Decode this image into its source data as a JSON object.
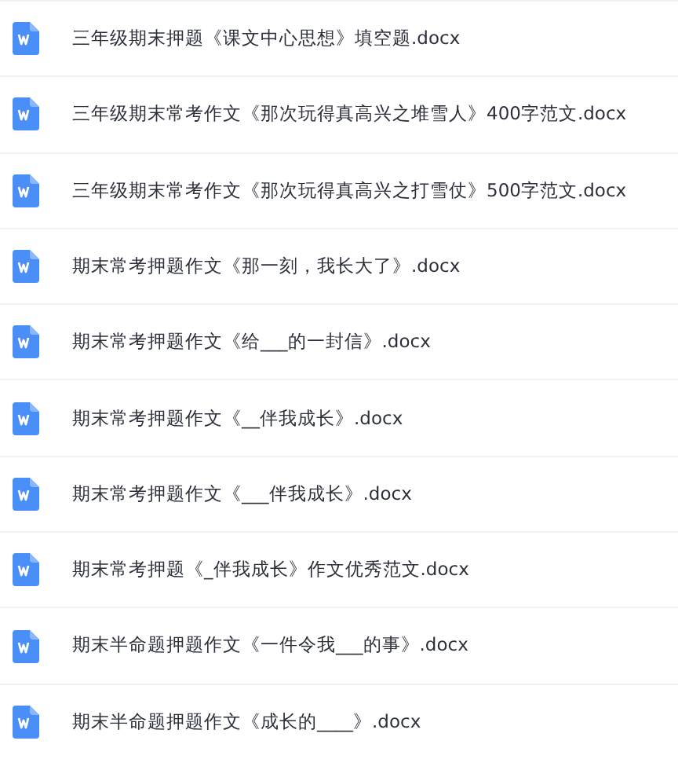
{
  "files": [
    {
      "name": "三年级期末押题《课文中心思想》填空题.docx"
    },
    {
      "name": "三年级期末常考作文《那次玩得真高兴之堆雪人》400字范文.docx"
    },
    {
      "name": "三年级期末常考作文《那次玩得真高兴之打雪仗》500字范文.docx"
    },
    {
      "name": "期末常考押题作文《那一刻，我长大了》.docx"
    },
    {
      "name": "期末常考押题作文《给___的一封信》.docx"
    },
    {
      "name": "期末常考押题作文《__伴我成长》.docx"
    },
    {
      "name": "期末常考押题作文《___伴我成长》.docx"
    },
    {
      "name": "期末常考押题《_伴我成长》作文优秀范文.docx"
    },
    {
      "name": "期末半命题押题作文《一件令我___的事》.docx"
    },
    {
      "name": "期末半命题押题作文《成长的____》.docx"
    }
  ]
}
